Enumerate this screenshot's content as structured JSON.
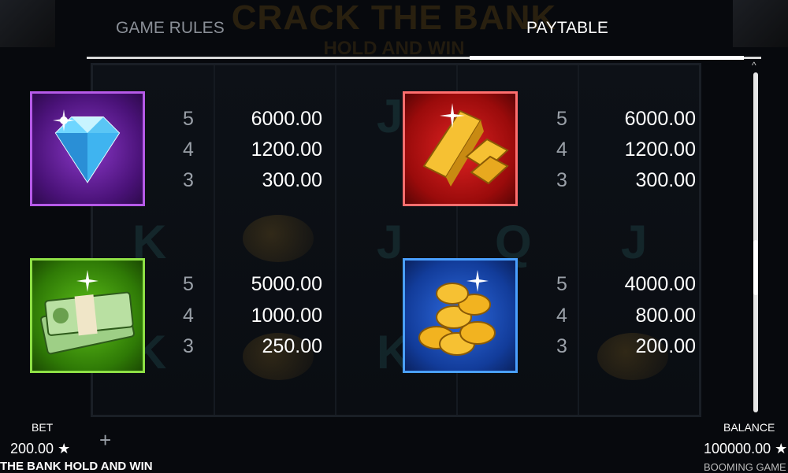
{
  "tabs": {
    "rules": "GAME RULES",
    "paytable": "PAYTABLE"
  },
  "background": {
    "logo": "CRACK THE BANK",
    "logo_sub": "HOLD AND WIN"
  },
  "paytable": [
    {
      "symbol": "diamond-icon",
      "rows": [
        {
          "count": "5",
          "value": "6000.00"
        },
        {
          "count": "4",
          "value": "1200.00"
        },
        {
          "count": "3",
          "value": "300.00"
        }
      ]
    },
    {
      "symbol": "gold-bars-icon",
      "rows": [
        {
          "count": "5",
          "value": "6000.00"
        },
        {
          "count": "4",
          "value": "1200.00"
        },
        {
          "count": "3",
          "value": "300.00"
        }
      ]
    },
    {
      "symbol": "cash-stack-icon",
      "rows": [
        {
          "count": "5",
          "value": "5000.00"
        },
        {
          "count": "4",
          "value": "1000.00"
        },
        {
          "count": "3",
          "value": "250.00"
        }
      ]
    },
    {
      "symbol": "gold-coins-icon",
      "rows": [
        {
          "count": "5",
          "value": "4000.00"
        },
        {
          "count": "4",
          "value": "800.00"
        },
        {
          "count": "3",
          "value": "200.00"
        }
      ]
    }
  ],
  "bottom": {
    "bet_label": "BET",
    "bet_value": "200.00",
    "game_name": "THE BANK HOLD AND WIN",
    "balance_label": "BALANCE",
    "balance_value": "100000.00",
    "brand": "BOOMING GAME"
  },
  "colors": {
    "diamond_frame": "#b65ae8",
    "gold_frame": "#ff6e6e",
    "cash_frame": "#8ee045",
    "coins_frame": "#4aa0ff"
  }
}
